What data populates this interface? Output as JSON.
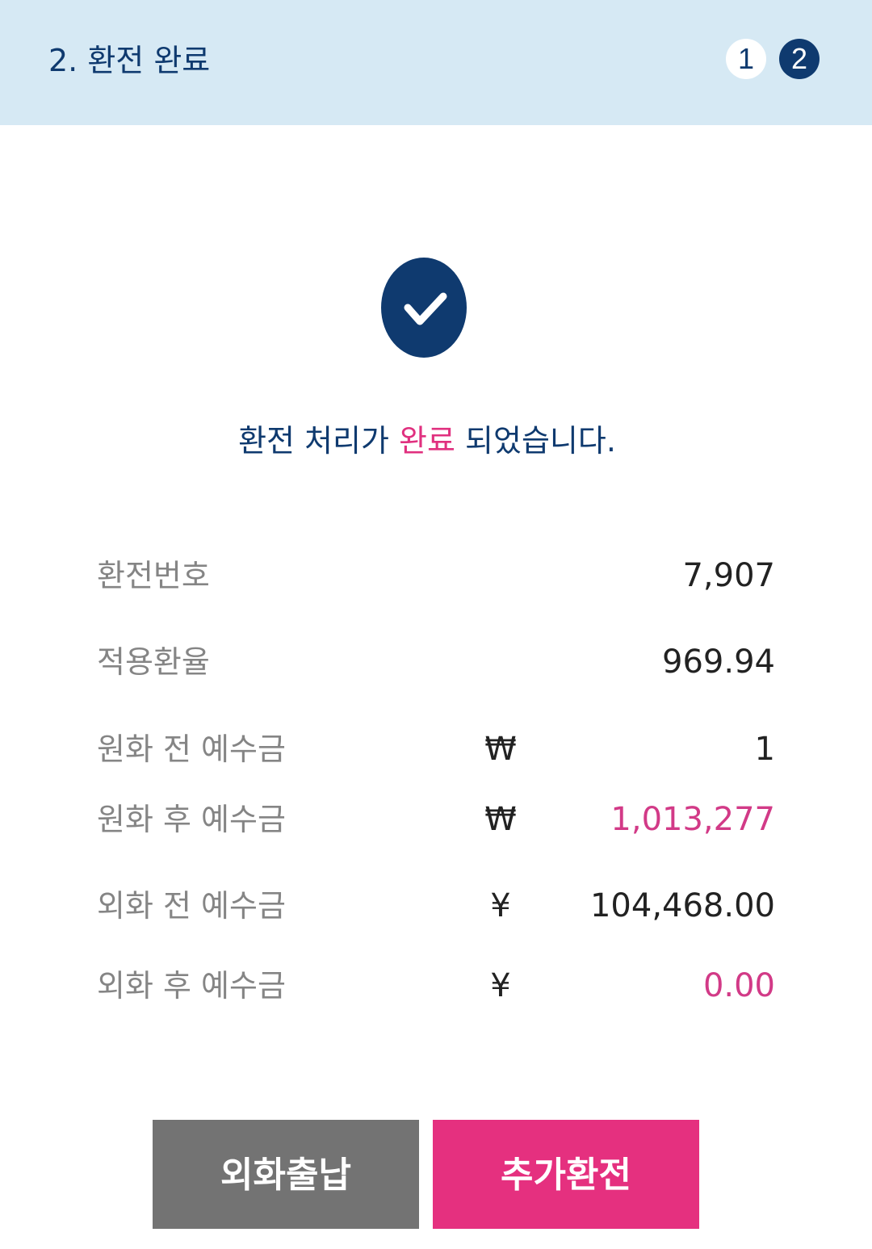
{
  "header": {
    "title": "2. 환전 완료",
    "steps": [
      "1",
      "2"
    ]
  },
  "status": {
    "icon": "check-icon",
    "message_before": "환전 처리가 ",
    "message_accent": "완료",
    "message_after": " 되었습니다."
  },
  "details": [
    {
      "label": "환전번호",
      "currency": "",
      "value": "7,907"
    },
    {
      "label": "적용환율",
      "currency": "",
      "value": "969.94"
    },
    {
      "label": "원화 전 예수금",
      "currency": "₩",
      "value": "1"
    },
    {
      "label": "원화 후 예수금",
      "currency": "₩",
      "value": "1,013,277"
    },
    {
      "label": "외화 전 예수금",
      "currency": "¥",
      "value": "104,468.00"
    },
    {
      "label": "외화 후 예수금",
      "currency": "¥",
      "value": "0.00"
    }
  ],
  "buttons": {
    "foreign_deposit_withdraw": "외화출납",
    "additional_exchange": "추가환전"
  },
  "colors": {
    "navy": "#0f3a6f",
    "header_bg": "#d6e9f4",
    "accent_pink": "#e5307f",
    "gray_button": "#737373"
  }
}
